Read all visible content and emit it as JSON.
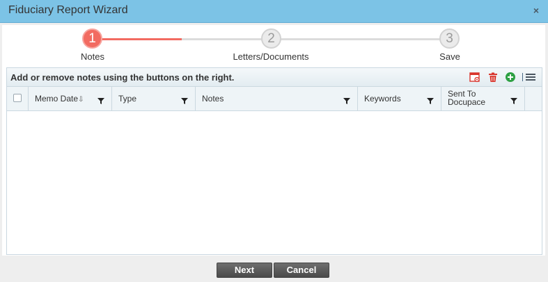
{
  "window": {
    "title": "Fiduciary Report Wizard",
    "close_glyph": "×"
  },
  "stepper": {
    "steps": [
      {
        "number": "1",
        "label": "Notes",
        "state": "active"
      },
      {
        "number": "2",
        "label": "Letters/Documents",
        "state": "todo"
      },
      {
        "number": "3",
        "label": "Save",
        "state": "todo"
      }
    ]
  },
  "grid": {
    "instruction": "Add or remove notes using the buttons on the right.",
    "toolbar_icons": [
      "calendar-settings-icon",
      "trash-icon",
      "add-circle-icon",
      "column-menu-icon"
    ],
    "columns": [
      {
        "label": "Memo Date",
        "sort_glyph": "⇩"
      },
      {
        "label": "Type"
      },
      {
        "label": "Notes"
      },
      {
        "label": "Keywords"
      },
      {
        "label": "Sent To Docupace"
      }
    ],
    "rows": []
  },
  "footer": {
    "next_label": "Next",
    "cancel_label": "Cancel"
  },
  "colors": {
    "titlebar": "#7cc3e6",
    "accent_active_step": "#f26b61",
    "button_dark": "#5a5a5a"
  }
}
